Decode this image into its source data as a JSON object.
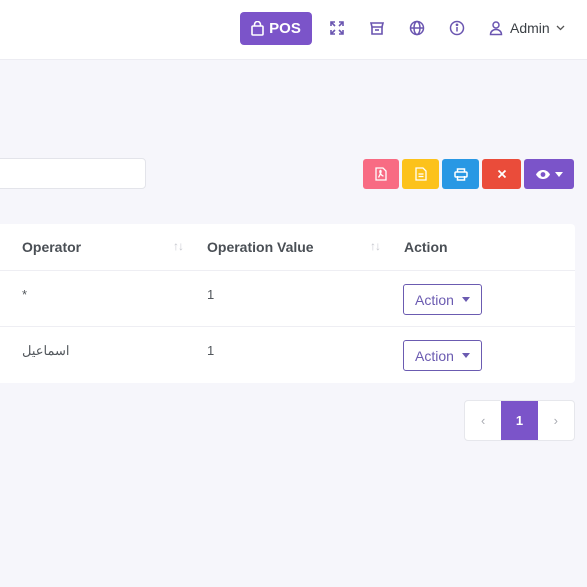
{
  "header": {
    "pos_label": "POS",
    "icons": [
      "fullscreen-icon",
      "store-icon",
      "globe-icon",
      "info-icon",
      "user-icon"
    ],
    "user_label": "Admin"
  },
  "toolbar": {
    "search_value": "",
    "buttons": [
      "pdf-icon",
      "csv-icon",
      "print-icon",
      "delete-icon",
      "eye-icon"
    ]
  },
  "table": {
    "columns": [
      {
        "label": "Operator",
        "sortable": true
      },
      {
        "label": "Operation Value",
        "sortable": true
      },
      {
        "label": "Action",
        "sortable": false
      }
    ],
    "rows": [
      {
        "operator": "*",
        "operation_value": "1",
        "action_label": "Action"
      },
      {
        "operator": "اسماعيل",
        "operation_value": "1",
        "action_label": "Action"
      }
    ]
  },
  "pagination": {
    "prev": "‹",
    "current": "1",
    "next": "›"
  },
  "colors": {
    "primary": "#7b54c9",
    "pdf": "#f86b83",
    "csv": "#fcc21b",
    "print": "#2998e4",
    "delete": "#ea4c3a"
  }
}
